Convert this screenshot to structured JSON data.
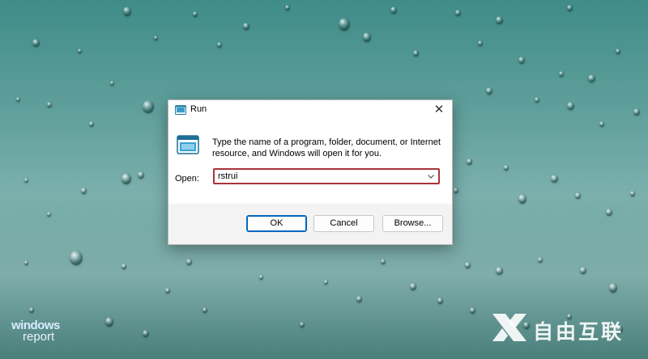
{
  "dialog": {
    "title": "Run",
    "close_glyph": "✕",
    "description": "Type the name of a program, folder, document, or Internet resource, and Windows will open it for you.",
    "open_label": "Open:",
    "open_value": "rstrui",
    "buttons": {
      "ok": "OK",
      "cancel": "Cancel",
      "browse": "Browse..."
    },
    "icons": [
      "run-icon",
      "close-icon",
      "chevron-down-icon"
    ],
    "colors": {
      "focus_outline": "#a8343a",
      "default_button_border": "#0067c0"
    }
  },
  "watermarks": {
    "left_line1": "windows",
    "left_line2": "report",
    "right_text": "自由互联"
  }
}
